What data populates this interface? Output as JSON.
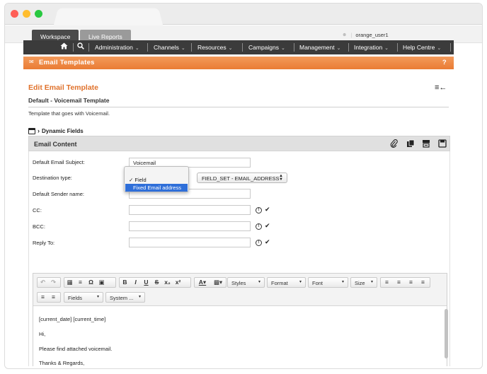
{
  "workspace_tabs": [
    {
      "label": "Workspace"
    },
    {
      "label": "Live Reports"
    }
  ],
  "user": {
    "name": "orange_user1"
  },
  "nav": {
    "items": [
      {
        "label": "Administration"
      },
      {
        "label": "Channels"
      },
      {
        "label": "Resources"
      },
      {
        "label": "Campaigns"
      },
      {
        "label": "Management"
      },
      {
        "label": "Integration"
      },
      {
        "label": "Help Centre"
      }
    ]
  },
  "module": {
    "title": "Email Templates",
    "help": "?"
  },
  "page": {
    "title": "Edit Email Template",
    "subtitle": "Default - Voicemail Template",
    "description": "Template that goes with Voicemail.",
    "dynamic_fields": "Dynamic Fields"
  },
  "section": {
    "title": "Email Content"
  },
  "form": {
    "subject_label": "Default Email Subject:",
    "subject_value": "Voicemail",
    "dest_label": "Destination type:",
    "dest_options": [
      "Field",
      "Fixed Email address"
    ],
    "dest_selected_check": "✓",
    "field_select_value": "FIELD_SET - EMAIL_ADDRESS",
    "sender_label": "Default Sender name:",
    "sender_value": "",
    "cc_label": "CC:",
    "cc_value": "",
    "bcc_label": "BCC:",
    "bcc_value": "",
    "replyto_label": "Reply To:",
    "replyto_value": ""
  },
  "editor": {
    "dropdowns": {
      "styles": "Styles",
      "format": "Format",
      "font": "Font",
      "size": "Size",
      "fields": "Fields",
      "system": "System ..."
    },
    "content_lines": [
      "[current_date] [current_time]",
      "Hi,",
      "Please find attached voicemail.",
      "Thanks & Regards,"
    ]
  },
  "colors": {
    "accent": "#ea7c34",
    "nav_bg": "#3b3b3b",
    "selection": "#2f6fd9"
  },
  "icons": [
    "home-icon",
    "search-icon",
    "envelope-icon",
    "menu-back-icon",
    "calendar-icon",
    "attach-icon",
    "copy-icon",
    "template-icon",
    "save-icon"
  ]
}
